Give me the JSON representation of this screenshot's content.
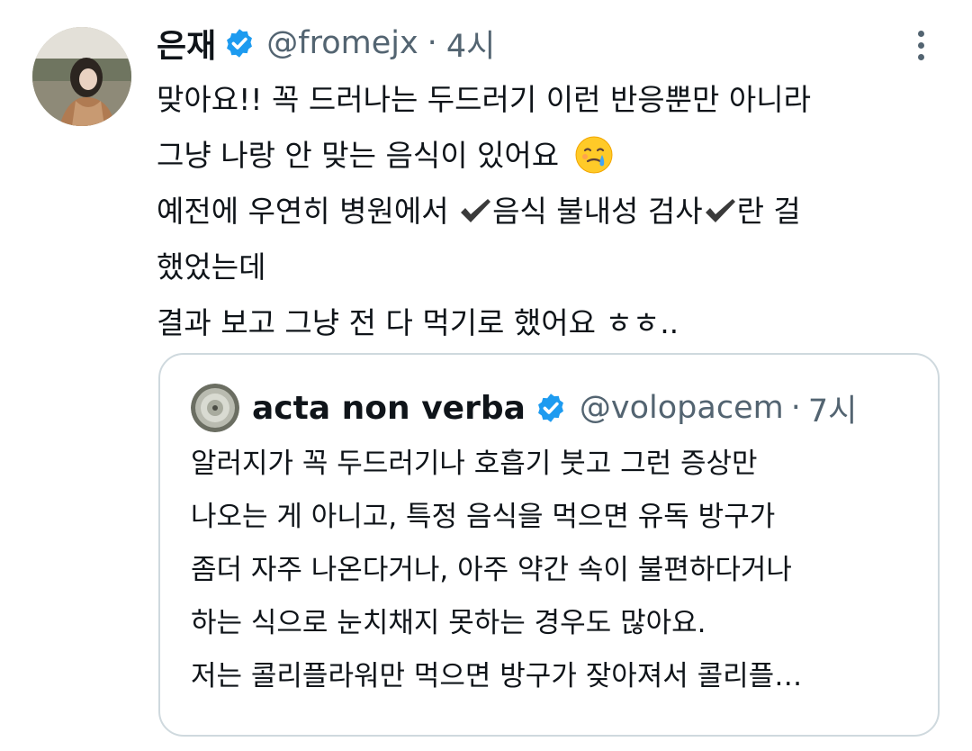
{
  "tweet": {
    "author_name": "은재",
    "handle": "@fromejx",
    "separator": "·",
    "time": "4시",
    "icons": {
      "verified": "verified-badge-icon",
      "more": "more-vertical-icon",
      "check": "heavy-check-mark-icon",
      "emoji": "face-holding-back-tears-emoji"
    },
    "colors": {
      "verified_blue": "#1d9bf0",
      "secondary_text": "#536471",
      "border": "#cfd9de"
    },
    "lines": {
      "l1": "맞아요!! 꼭 드러나는 두드러기 이런 반응뿐만 아니라",
      "l2": "그냥 나랑 안 맞는 음식이 있어요",
      "l3_a": "예전에 우연히 병원에서 ",
      "l3_b": "음식 불내성 검사",
      "l3_c": "란 걸",
      "l4": "했었는데",
      "l5": "결과 보고 그냥 전 다 먹기로 했어요 ㅎㅎ.."
    }
  },
  "quoted": {
    "author_name": "acta non verba",
    "handle": "@volopacem",
    "separator": "·",
    "time": "7시",
    "lines": [
      "알러지가 꼭 두드러기나 호흡기 붓고 그런 증상만",
      "나오는 게 아니고, 특정 음식을 먹으면 유독 방구가",
      "좀더 자주 나온다거나, 아주 약간 속이 불편하다거나",
      "하는 식으로 눈치채지 못하는 경우도 많아요.",
      "저는 콜리플라워만 먹으면 방구가 잦아져서 콜리플…"
    ]
  }
}
